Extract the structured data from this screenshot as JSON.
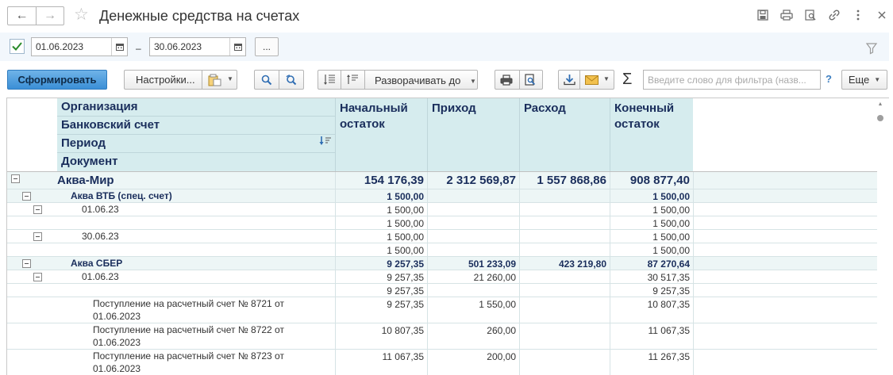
{
  "window": {
    "title": "Денежные средства на счетах"
  },
  "period": {
    "enabled": true,
    "date_from": "01.06.2023",
    "dash": "–",
    "date_to": "30.06.2023",
    "more": "..."
  },
  "toolbar": {
    "generate": "Сформировать",
    "settings": "Настройки...",
    "expand_to": "Разворачивать до",
    "sigma": "Σ",
    "search_placeholder": "Введите слово для фильтра (назв...",
    "help": "?",
    "more": "Еще"
  },
  "report": {
    "header_left": [
      "Организация",
      "Банковский счет",
      "Период",
      "Документ"
    ],
    "columns": [
      {
        "line1": "Начальный",
        "line2": "остаток"
      },
      {
        "line1": "Приход",
        "line2": ""
      },
      {
        "line1": "Расход",
        "line2": ""
      },
      {
        "line1": "Конечный",
        "line2": "остаток"
      }
    ],
    "rows": [
      {
        "label": "Аква-Мир",
        "level": 0,
        "values": [
          "154 176,39",
          "2 312 569,87",
          "1 557 868,86",
          "908 877,40"
        ]
      },
      {
        "label": "Аква ВТБ (спец. счет)",
        "level": 1,
        "values": [
          "1 500,00",
          "",
          "",
          "1 500,00"
        ]
      },
      {
        "label": "01.06.23",
        "level": 2,
        "values": [
          "1 500,00",
          "",
          "",
          "1 500,00"
        ]
      },
      {
        "label": "",
        "level": 3,
        "values": [
          "1 500,00",
          "",
          "",
          "1 500,00"
        ]
      },
      {
        "label": "30.06.23",
        "level": 2,
        "values": [
          "1 500,00",
          "",
          "",
          "1 500,00"
        ]
      },
      {
        "label": "",
        "level": 3,
        "values": [
          "1 500,00",
          "",
          "",
          "1 500,00"
        ]
      },
      {
        "label": "Аква СБЕР",
        "level": 1,
        "values": [
          "9 257,35",
          "501 233,09",
          "423 219,80",
          "87 270,64"
        ]
      },
      {
        "label": "01.06.23",
        "level": 2,
        "values": [
          "9 257,35",
          "21 260,00",
          "",
          "30 517,35"
        ]
      },
      {
        "label": "",
        "level": 3,
        "values": [
          "9 257,35",
          "",
          "",
          "9 257,35"
        ]
      },
      {
        "label": "Поступление на расчетный счет № 8721 от",
        "label2": "01.06.2023",
        "level": 3,
        "values": [
          "9 257,35",
          "1 550,00",
          "",
          "10 807,35"
        ]
      },
      {
        "label": "Поступление на расчетный счет № 8722 от",
        "label2": "01.06.2023",
        "level": 3,
        "values": [
          "10 807,35",
          "260,00",
          "",
          "11 067,35"
        ]
      },
      {
        "label": "Поступление на расчетный счет № 8723 от",
        "label2": "01.06.2023",
        "level": 3,
        "values": [
          "11 067,35",
          "200,00",
          "",
          "11 267,35"
        ]
      }
    ]
  },
  "colors": {
    "header_bg": "#d6ecee",
    "header_text": "#1a2e5c",
    "group_bg": "#edf6f6",
    "primary_btn": "#4b9ee0"
  }
}
